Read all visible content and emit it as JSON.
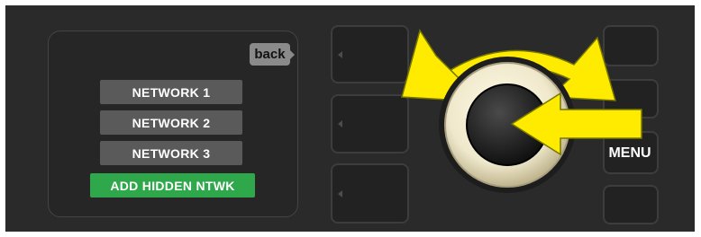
{
  "display": {
    "back_label": "back",
    "networks": [
      {
        "label": "NETWORK 1"
      },
      {
        "label": "NETWORK 2"
      },
      {
        "label": "NETWORK 3"
      },
      {
        "label": "ADD HIDDEN NTWK",
        "selected": true
      }
    ]
  },
  "hardware": {
    "menu_label": "MENU",
    "knob": {
      "rotation": "both-directions",
      "press": true
    }
  },
  "colors": {
    "panel": "#2a2a2a",
    "screen": "#262626",
    "item": "#5a5a5a",
    "selected_item": "#2ea84a",
    "arrow": "#ffeb00",
    "knob_ring": "#efe8cc"
  },
  "icons": [
    "rotate-arrows-icon",
    "press-arrow-icon",
    "knob-icon"
  ]
}
